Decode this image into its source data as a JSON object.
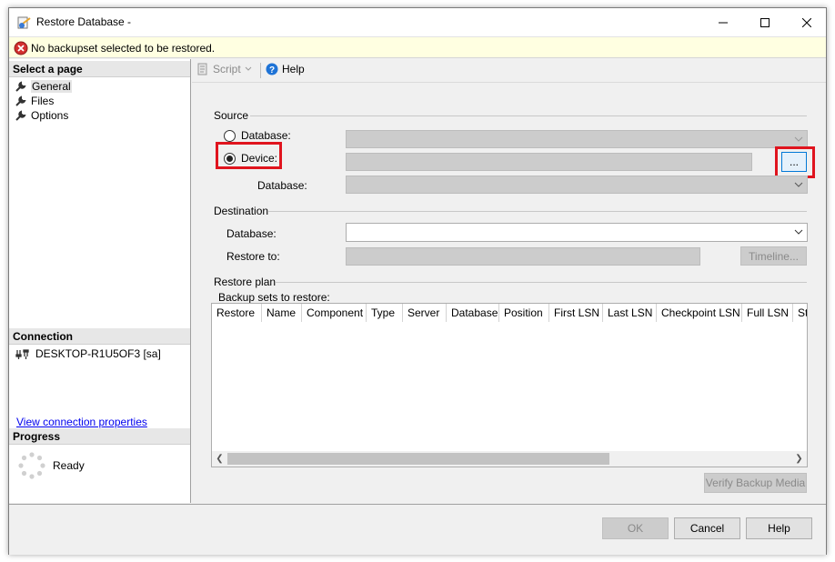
{
  "window": {
    "title": "Restore Database -"
  },
  "error": {
    "message": "No backupset selected to be restored."
  },
  "left": {
    "select_page_header": "Select a page",
    "pages": [
      "General",
      "Files",
      "Options"
    ],
    "connection_header": "Connection",
    "connection_name": "DESKTOP-R1U5OF3 [sa]",
    "view_connection_link": "View connection properties",
    "progress_header": "Progress",
    "progress_status": "Ready"
  },
  "toolbar": {
    "script_label": "Script",
    "help_label": "Help"
  },
  "source": {
    "group_label": "Source",
    "database_radio_label": "Database:",
    "device_radio_label": "Device:",
    "database_label": "Database:",
    "browse_label": "...",
    "selected_option": "Device"
  },
  "destination": {
    "group_label": "Destination",
    "database_label": "Database:",
    "restore_to_label": "Restore to:",
    "timeline_label": "Timeline..."
  },
  "restore_plan": {
    "group_label": "Restore plan",
    "backup_sets_label": "Backup sets to restore:",
    "columns": [
      "Restore",
      "Name",
      "Component",
      "Type",
      "Server",
      "Database",
      "Position",
      "First LSN",
      "Last LSN",
      "Checkpoint LSN",
      "Full LSN",
      "St"
    ],
    "verify_label": "Verify Backup Media"
  },
  "buttons": {
    "ok": "OK",
    "cancel": "Cancel",
    "help": "Help"
  },
  "colors": {
    "highlight": "#e0141e",
    "error_bar": "#ffffe1",
    "link": "#0000ee"
  }
}
